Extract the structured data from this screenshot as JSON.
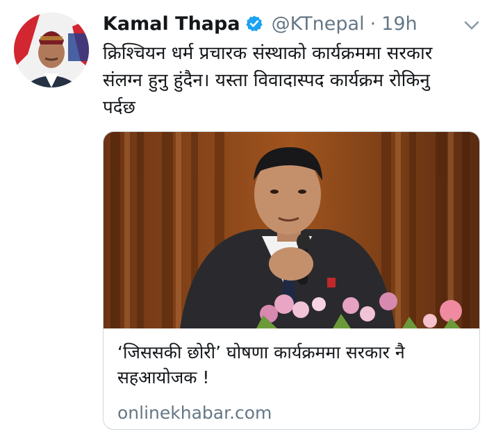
{
  "tweet": {
    "author_name": "Kamal Thapa",
    "handle": "@KTnepal",
    "separator": "·",
    "time": "19h",
    "text": "क्रिश्चियन धर्म प्रचारक संस्थाको कार्यक्रममा सरकार\nसंलग्न हुनु हुंदैन। यस्ता विवादास्पद कार्यक्रम रोकिनु\nपर्दछ",
    "verified_icon": "verified-badge-icon",
    "menu_icon": "chevron-down-icon"
  },
  "card": {
    "title": "‘जिससकी छोरी’ घोषणा कार्यक्रममा सरकार नै सहआयोजक !",
    "domain": "onlinekhabar.com"
  },
  "colors": {
    "verified": "#1da1f2",
    "secondary_text": "#657786",
    "card_border": "#ccd6dd"
  }
}
